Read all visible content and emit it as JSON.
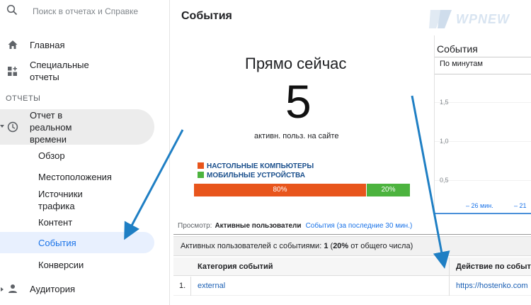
{
  "search": {
    "placeholder": "Поиск в отчетах и Справке"
  },
  "sidebar": {
    "home": "Главная",
    "special_line1": "Специальные",
    "special_line2": "отчеты",
    "section": "ОТЧЕТЫ",
    "realtime_line1": "Отчет в",
    "realtime_line2": "реальном",
    "realtime_line3": "времени",
    "sub": {
      "overview": "Обзор",
      "locations": "Местоположения",
      "traffic_line1": "Источники",
      "traffic_line2": "трафика",
      "content": "Контент",
      "events": "События",
      "conversions": "Конверсии"
    },
    "audience": "Аудитория"
  },
  "main": {
    "title": "События",
    "right_now": "Прямо сейчас",
    "active_count": "5",
    "active_label": "активн. польз. на сайте",
    "legend_desktop": "НАСТОЛЬНЫЕ КОМПЬЮТЕРЫ",
    "legend_mobile": "МОБИЛЬНЫЕ УСТРОЙСТВА",
    "desktop_pct_label": "80%",
    "mobile_pct_label": "20%",
    "desktop_fraction": 0.8,
    "mobile_fraction": 0.2,
    "colors": {
      "desktop": "#e8551c",
      "mobile": "#4cb33e"
    },
    "view_label": "Просмотр:",
    "view_active": "Активные пользователи",
    "view_link": "События (за последние 30 мин.)",
    "summary_prefix": "Активных пользователей с событиями:",
    "summary_count": "1",
    "summary_pct": "20%",
    "summary_open": "(",
    "summary_suffix": "от общего числа)",
    "table": {
      "col_category": "Категория событий",
      "col_action": "Действие по событи",
      "rows": [
        {
          "num": "1.",
          "category": "external",
          "action": "https://hostenko.com"
        }
      ]
    }
  },
  "right_panel": {
    "title": "События",
    "subtitle": "По минутам",
    "ticks": [
      "1,5",
      "1,0",
      "0,5"
    ],
    "x_labels": [
      "– 26 мин.",
      "– 21"
    ]
  },
  "watermark": {
    "text": "WPNEW"
  }
}
